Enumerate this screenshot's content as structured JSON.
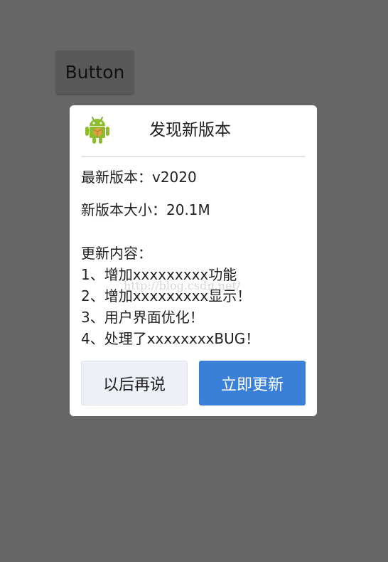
{
  "background": {
    "button_label": "Button"
  },
  "dialog": {
    "title": "发现新版本",
    "app_icon": "android-icon",
    "latest_version": "最新版本：v2020",
    "size": "新版本大小：20.1M",
    "changelog_heading": "更新内容：",
    "changelog": [
      "1、增加xxxxxxxxx功能",
      "2、增加xxxxxxxxx显示！",
      "3、用户界面优化！",
      "4、处理了xxxxxxxxBUG！"
    ],
    "watermark": "http://blog.csdn.net/",
    "later_label": "以后再说",
    "update_label": "立即更新"
  },
  "colors": {
    "overlay": "#666666",
    "primary_button": "#3a7fd8",
    "secondary_button": "#edf1f7",
    "android_green": "#8dbd2c"
  }
}
